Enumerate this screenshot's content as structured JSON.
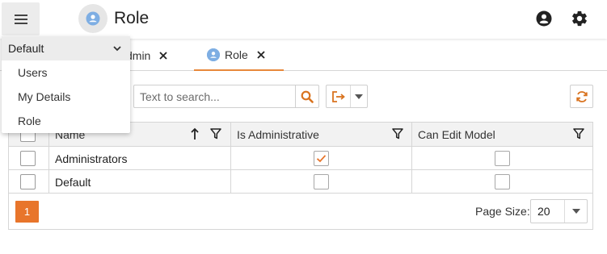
{
  "header": {
    "title": "Role",
    "menu_icon": "hamburger-menu-icon",
    "app_icon": "role-avatar-icon",
    "user_icon": "account-circle-icon",
    "settings_icon": "gear-icon"
  },
  "tabs": [
    {
      "label": "dmin",
      "active": false
    },
    {
      "label": "Role",
      "active": true
    }
  ],
  "toolbar": {
    "search_placeholder": "Text to search..."
  },
  "grid": {
    "columns": [
      "Name",
      "Is Administrative",
      "Can Edit Model"
    ],
    "rows": [
      {
        "name": "Administrators",
        "is_administrative": true,
        "can_edit_model": false
      },
      {
        "name": "Default",
        "is_administrative": false,
        "can_edit_model": false
      }
    ]
  },
  "pager": {
    "current_page": "1",
    "page_size_label": "Page Size:",
    "page_size": "20"
  },
  "dropdown": {
    "selected": "Default",
    "items": [
      "Users",
      "My Details",
      "Role"
    ]
  },
  "colors": {
    "accent": "#e8752b",
    "active_tab_underline": "#e8883a",
    "icon_blue": "#7eaee3"
  }
}
